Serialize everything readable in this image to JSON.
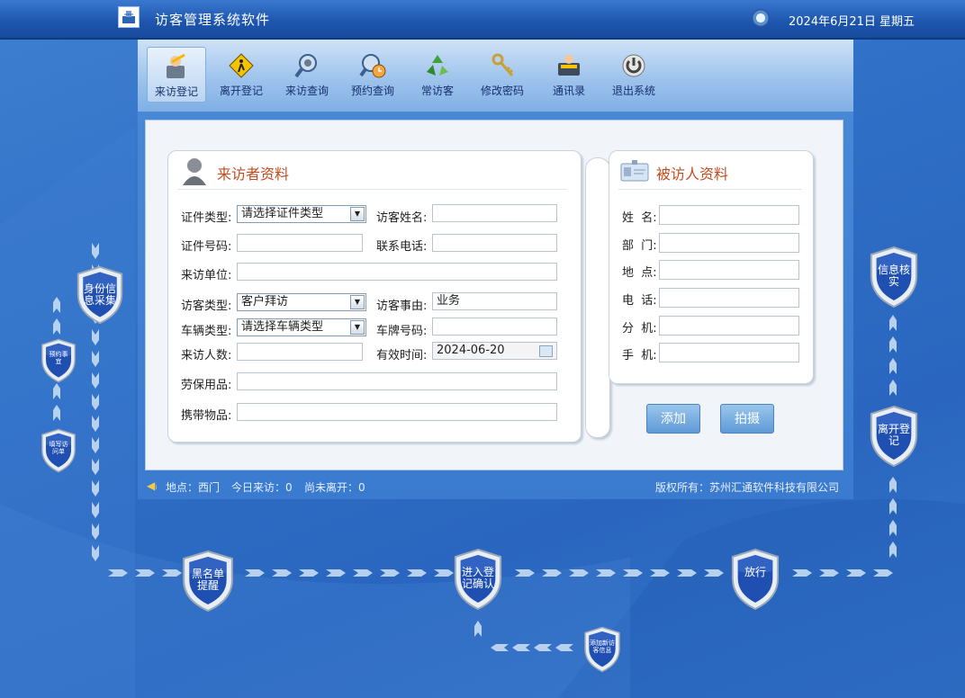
{
  "window": {
    "title": "访客管理系统软件",
    "datetime": "2024年6月21日  星期五"
  },
  "toolbar": [
    {
      "label": "来访登记",
      "icon": "visitor-register-icon"
    },
    {
      "label": "离开登记",
      "icon": "leave-register-icon"
    },
    {
      "label": "来访查询",
      "icon": "visit-search-icon"
    },
    {
      "label": "预约查询",
      "icon": "appointment-search-icon"
    },
    {
      "label": "常访客",
      "icon": "frequent-visitor-icon"
    },
    {
      "label": "修改密码",
      "icon": "keys-icon"
    },
    {
      "label": "通讯录",
      "icon": "address-book-icon"
    },
    {
      "label": "退出系统",
      "icon": "power-icon"
    }
  ],
  "visitor": {
    "header": "来访者资料",
    "id_type_label": "证件类型:",
    "id_type_value": "请选择证件类型",
    "name_label": "访客姓名:",
    "name_value": "",
    "id_no_label": "证件号码:",
    "id_no_value": "",
    "phone_label": "联系电话:",
    "phone_value": "",
    "unit_label": "来访单位:",
    "unit_value": "",
    "visit_type_label": "访客类型:",
    "visit_type_value": "客户拜访",
    "reason_label": "访客事由:",
    "reason_value": "业务",
    "vehicle_type_label": "车辆类型:",
    "vehicle_type_value": "请选择车辆类型",
    "plate_label": "车牌号码:",
    "plate_value": "",
    "count_label": "来访人数:",
    "count_value": "",
    "valid_label": "有效时间:",
    "valid_value": "2024-06-20",
    "protect_label": "劳保用品:",
    "protect_value": "",
    "carry_label": "携带物品:",
    "carry_value": ""
  },
  "visited": {
    "header": "被访人资料",
    "fields": [
      {
        "label": "姓  名:",
        "value": ""
      },
      {
        "label": "部  门:",
        "value": ""
      },
      {
        "label": "地  点:",
        "value": ""
      },
      {
        "label": "电  话:",
        "value": ""
      },
      {
        "label": "分  机:",
        "value": ""
      },
      {
        "label": "手  机:",
        "value": ""
      }
    ]
  },
  "buttons": {
    "add": "添加",
    "shoot": "拍摄"
  },
  "status": {
    "location": "地点：西门",
    "today": "今日来访：0",
    "not_left": "尚未离开：0",
    "copyright": "版权所有：苏州汇通软件科技有限公司"
  },
  "flow": {
    "id_collect": "身份信息采集",
    "appointment": "预约事宜",
    "fill_form": "填写访问单",
    "blacklist": "黑名单提醒",
    "entry_confirm": "进入登记确认",
    "add_visitor": "添加新访客信息",
    "release": "放行",
    "verify": "信息核实",
    "leave_register": "离开登记"
  },
  "colors": {
    "accent": "#2f6fc6",
    "header_orange": "#c24d1f",
    "shield_blue": "#1f4fb0"
  }
}
